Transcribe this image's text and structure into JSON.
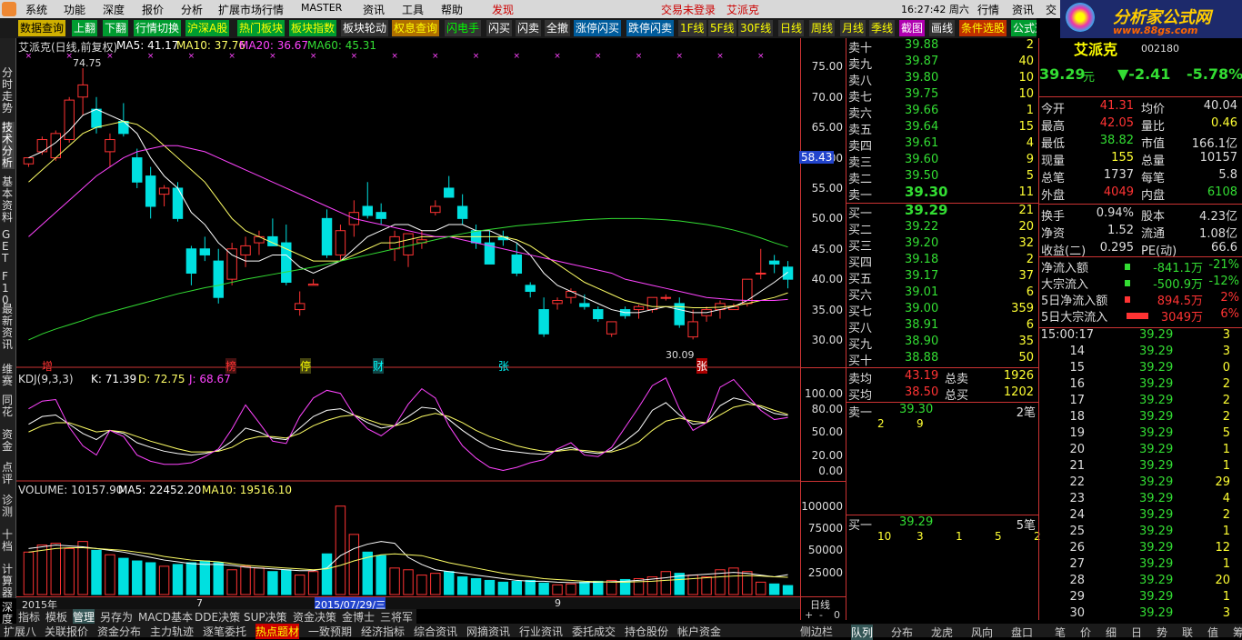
{
  "menu": {
    "items": [
      "系统",
      "功能",
      "深度",
      "报价",
      "分析",
      "扩展市场行情",
      "MASTER",
      "资讯",
      "工具",
      "帮助",
      "发现"
    ],
    "login": "交易未登录",
    "stock": "艾派克",
    "clock": "16:27:42 周六",
    "right": [
      "行情",
      "资讯",
      "交"
    ]
  },
  "toolbar": [
    "数据查询",
    "上翻",
    "下翻",
    "行情切换",
    "沪深A股",
    "热门板块",
    "板块指数",
    "板块轮动",
    "权息查询",
    "闪电手",
    "闪买",
    "闪卖",
    "全撤",
    "涨停闪买",
    "跌停闪卖",
    "1F线",
    "5F线",
    "30F线",
    "日线",
    "周线",
    "月线",
    "季线",
    "截图",
    "画线",
    "条件选股",
    "公式选"
  ],
  "logo": {
    "title": "分析家公式网",
    "url": "www.88gs.com"
  },
  "lefttabs": [
    "分时走势",
    "技术分析",
    "基本资料",
    "GET",
    "F10",
    "最新资讯",
    "维赛",
    "同花",
    "资金",
    "点评",
    "诊测",
    "十档",
    "计算器",
    "深度"
  ],
  "chart_data": [
    {
      "type": "candlestick",
      "title": "艾派克(日线,前复权)",
      "legend": [
        {
          "name": "MA5",
          "value": "41.17"
        },
        {
          "name": "MA10",
          "value": "37.76"
        },
        {
          "name": "MA20",
          "value": "36.67"
        },
        {
          "name": "MA60",
          "value": "45.31"
        }
      ],
      "ylim": [
        27,
        77
      ],
      "yticks": [
        "75.00",
        "70.00",
        "65.00",
        "60.00",
        "55.00",
        "50.00",
        "45.00",
        "40.00",
        "35.00",
        "30.00"
      ],
      "annotations": {
        "high": "74.75",
        "low": "30.09",
        "marker": "58.43"
      },
      "events": [
        "增",
        "榜",
        "停",
        "财",
        "张"
      ],
      "candles": [
        [
          59,
          60,
          58.5,
          60
        ],
        [
          61,
          63.5,
          60.5,
          63
        ],
        [
          60,
          64.5,
          59.5,
          64
        ],
        [
          63,
          70,
          62.5,
          69.5
        ],
        [
          70,
          74.75,
          67,
          72
        ],
        [
          68,
          70,
          64,
          65
        ],
        [
          61,
          64,
          58.5,
          63
        ],
        [
          66,
          69,
          63.5,
          64
        ],
        [
          60,
          61.5,
          55,
          56
        ],
        [
          57,
          58.5,
          50,
          52
        ],
        [
          54,
          55.5,
          52,
          55
        ],
        [
          55,
          56,
          49.5,
          50
        ],
        [
          45,
          45.5,
          39,
          41
        ],
        [
          45,
          47,
          43,
          44
        ],
        [
          43,
          45,
          36,
          37
        ],
        [
          40,
          46,
          39,
          45
        ],
        [
          44,
          47,
          42,
          45.5
        ],
        [
          46,
          48,
          44,
          47
        ],
        [
          47,
          50,
          45.5,
          45.5
        ],
        [
          46,
          49,
          39,
          39.5
        ],
        [
          35,
          38,
          34,
          36
        ],
        [
          39,
          40,
          39,
          39.2
        ],
        [
          50,
          51.5,
          43.5,
          44
        ],
        [
          44,
          49,
          43,
          48
        ],
        [
          49,
          53,
          47,
          51
        ],
        [
          52,
          56,
          50,
          50.5
        ],
        [
          51,
          52.5,
          49,
          50
        ],
        [
          45,
          48,
          43,
          47
        ],
        [
          44,
          47.5,
          42,
          47.5
        ],
        [
          46,
          48,
          45,
          46.5
        ],
        [
          51,
          53,
          50.5,
          52
        ],
        [
          55,
          57,
          53.5,
          53.5
        ],
        [
          52,
          54,
          49,
          50
        ],
        [
          48,
          49,
          45,
          46
        ],
        [
          46,
          48,
          42.5,
          42.5
        ],
        [
          47,
          48,
          45.5,
          46.5
        ],
        [
          44,
          46,
          40.5,
          41
        ],
        [
          39,
          39.5,
          37,
          38
        ],
        [
          35,
          37,
          30.5,
          31
        ],
        [
          36,
          37,
          35,
          36.5
        ],
        [
          37,
          38.5,
          36,
          38
        ],
        [
          36,
          37.5,
          35,
          35.5
        ],
        [
          35,
          35.5,
          33,
          33.5
        ],
        [
          31,
          33,
          30.5,
          33
        ],
        [
          35,
          35.5,
          33.5,
          34
        ],
        [
          35,
          35.8,
          33.5,
          35.5
        ],
        [
          35,
          37,
          34.5,
          37
        ],
        [
          37,
          37.5,
          36.5,
          37
        ],
        [
          36,
          37,
          32,
          32.5
        ],
        [
          30.5,
          35,
          30.09,
          33
        ],
        [
          34,
          35.5,
          33,
          35
        ],
        [
          35,
          36.5,
          33.5,
          36
        ],
        [
          35,
          36,
          35,
          35.5
        ],
        [
          36,
          40,
          35.5,
          40
        ],
        [
          41,
          45,
          40,
          41
        ],
        [
          43,
          44,
          41,
          42.5
        ],
        [
          42,
          43,
          38.5,
          40
        ]
      ],
      "ma5": [
        60,
        61,
        62.5,
        64.5,
        67,
        68,
        67,
        66,
        64,
        60,
        57,
        55,
        51,
        49,
        46,
        44,
        43,
        43,
        44,
        44,
        42,
        41,
        42,
        43,
        45,
        47,
        48,
        49,
        49,
        48,
        48,
        49,
        49,
        48,
        48,
        47,
        46,
        44,
        41,
        39,
        38,
        37,
        36,
        35,
        34.5,
        34.5,
        35,
        35.5,
        35,
        34.5,
        34.5,
        35,
        35.5,
        36.5,
        38,
        39.5,
        41.17
      ],
      "ma10": [
        56,
        58,
        60,
        62,
        64,
        65,
        65.5,
        66,
        65.5,
        64,
        62,
        60,
        58,
        56,
        53,
        50,
        48,
        47,
        46,
        45,
        44,
        43,
        43,
        43,
        44,
        45,
        46,
        46,
        46.5,
        47,
        47,
        47,
        47,
        47,
        47,
        47,
        46.5,
        45.5,
        44,
        42.5,
        41,
        39.5,
        38.5,
        37.5,
        36.5,
        36,
        35.5,
        35.5,
        35.5,
        35.3,
        35.3,
        35.4,
        35.6,
        36,
        36.5,
        37,
        37.76
      ],
      "ma20": [
        47,
        49,
        51,
        53,
        55,
        57,
        58.5,
        60,
        61,
        61.5,
        62,
        62,
        61.5,
        61,
        60,
        59,
        58,
        57,
        56,
        55,
        54,
        53,
        52,
        51,
        50,
        49.5,
        49,
        48.5,
        48,
        47.5,
        47,
        47,
        46.5,
        46,
        45.5,
        45,
        44.5,
        44,
        43.5,
        43,
        42.5,
        42,
        41.5,
        41,
        40,
        39.5,
        39,
        38.5,
        38,
        37.5,
        37,
        36.8,
        36.6,
        36.5,
        36.5,
        36.5,
        36.67
      ],
      "ma60": [
        30,
        31,
        31.8,
        32.5,
        33.2,
        34,
        34.6,
        35.2,
        35.8,
        36.4,
        37,
        37.6,
        38.1,
        38.6,
        39,
        39.5,
        40,
        40.4,
        40.8,
        41.2,
        41.6,
        42,
        42.5,
        43,
        43.5,
        44,
        44.5,
        45,
        45.5,
        46,
        46.5,
        47,
        47.5,
        47.9,
        48.2,
        48.5,
        48.8,
        49,
        49.2,
        49.4,
        49.6,
        49.8,
        49.9,
        50,
        50,
        50,
        49.9,
        49.8,
        49.6,
        49.3,
        49,
        48.6,
        48.1,
        47.5,
        46.8,
        46,
        45.31
      ]
    },
    {
      "type": "line",
      "title": "KDJ(9,3,3)",
      "legend": [
        {
          "name": "K",
          "value": "71.39"
        },
        {
          "name": "D",
          "value": "72.75"
        },
        {
          "name": "J",
          "value": "68.67"
        }
      ],
      "ylim": [
        -10,
        115
      ],
      "yticks": [
        "100.00",
        "80.00",
        "50.00",
        "20.00",
        "0.00"
      ],
      "k": [
        60,
        70,
        72,
        60,
        48,
        40,
        52,
        48,
        36,
        30,
        25,
        22,
        20,
        22,
        26,
        38,
        55,
        50,
        42,
        40,
        55,
        70,
        78,
        80,
        72,
        62,
        55,
        58,
        70,
        82,
        80,
        66,
        52,
        40,
        30,
        26,
        24,
        22,
        21,
        26,
        30,
        24,
        22,
        26,
        38,
        52,
        78,
        88,
        72,
        60,
        62,
        84,
        94,
        90,
        82,
        74,
        71.39
      ],
      "d": [
        50,
        58,
        62,
        62,
        56,
        50,
        52,
        50,
        44,
        38,
        33,
        28,
        24,
        24,
        25,
        30,
        40,
        44,
        44,
        42,
        48,
        58,
        65,
        70,
        72,
        66,
        60,
        58,
        62,
        70,
        74,
        70,
        62,
        52,
        44,
        38,
        32,
        28,
        25,
        25,
        27,
        26,
        24,
        24,
        29,
        37,
        52,
        64,
        68,
        64,
        62,
        72,
        82,
        86,
        84,
        78,
        72.75
      ],
      "j": [
        80,
        90,
        92,
        56,
        32,
        20,
        52,
        44,
        20,
        12,
        8,
        8,
        10,
        18,
        28,
        54,
        85,
        62,
        38,
        35,
        70,
        94,
        104,
        100,
        72,
        54,
        45,
        58,
        86,
        106,
        94,
        58,
        32,
        16,
        4,
        0,
        4,
        10,
        14,
        28,
        36,
        20,
        18,
        30,
        56,
        82,
        110,
        120,
        80,
        52,
        62,
        108,
        118,
        98,
        78,
        66,
        68.67
      ]
    },
    {
      "type": "bar",
      "title": "VOLUME",
      "legend": [
        {
          "name": "VOLUME",
          "value": "10157.90"
        },
        {
          "name": "MA5",
          "value": "22452.20"
        },
        {
          "name": "MA10",
          "value": "19516.10"
        }
      ],
      "ylim": [
        0,
        110000
      ],
      "yticks": [
        "100000",
        "75000",
        "50000",
        "25000"
      ],
      "xlabels": [
        "2015年",
        "7",
        "2015/07/29/三",
        "9"
      ],
      "values": [
        48000,
        56000,
        58000,
        52000,
        60000,
        50000,
        45000,
        41000,
        38000,
        36000,
        32000,
        34000,
        36000,
        38000,
        36000,
        28000,
        32000,
        30000,
        26000,
        28000,
        22000,
        26000,
        46000,
        100000,
        68000,
        48000,
        44000,
        30000,
        28000,
        22000,
        24000,
        26000,
        20000,
        18000,
        16000,
        14000,
        15000,
        16000,
        13000,
        11000,
        12000,
        14000,
        15000,
        16000,
        17000,
        18000,
        20000,
        26000,
        24000,
        22000,
        20000,
        28000,
        30000,
        26000,
        14000,
        12000,
        10157.9
      ],
      "ma5": [
        52000,
        54000,
        56000,
        55000,
        54000,
        52000,
        50000,
        48000,
        45000,
        42000,
        39000,
        37000,
        35000,
        34000,
        34000,
        33000,
        31000,
        30000,
        29000,
        28000,
        27000,
        27000,
        30000,
        44000,
        52000,
        57000,
        60000,
        58000,
        42000,
        34000,
        28000,
        26000,
        24000,
        22000,
        20000,
        18000,
        16000,
        15000,
        15000,
        14000,
        13500,
        13500,
        14000,
        14500,
        15000,
        16000,
        17500,
        19000,
        21000,
        22000,
        23000,
        24000,
        25000,
        24000,
        22000,
        20000,
        22452.2
      ],
      "ma10": [
        48000,
        50000,
        52000,
        53000,
        53000,
        52000,
        51000,
        50000,
        48000,
        46000,
        43000,
        41000,
        39000,
        38000,
        37000,
        35000,
        33000,
        32000,
        31000,
        30000,
        29000,
        28000,
        29000,
        33000,
        38000,
        42000,
        45000,
        46000,
        45000,
        44000,
        40000,
        36000,
        33000,
        30000,
        27000,
        24000,
        22000,
        20000,
        18000,
        17000,
        16000,
        15000,
        14500,
        14000,
        14000,
        14500,
        15000,
        16000,
        17000,
        18000,
        19000,
        20000,
        21000,
        21500,
        21000,
        20000,
        19516.1
      ]
    }
  ],
  "chart_right_label": "日线",
  "orderbook": {
    "sell": [
      [
        "卖十",
        "39.88",
        "2"
      ],
      [
        "卖九",
        "39.87",
        "40"
      ],
      [
        "卖八",
        "39.80",
        "10"
      ],
      [
        "卖七",
        "39.75",
        "10"
      ],
      [
        "卖六",
        "39.66",
        "1"
      ],
      [
        "卖五",
        "39.64",
        "15"
      ],
      [
        "卖四",
        "39.61",
        "4"
      ],
      [
        "卖三",
        "39.60",
        "9"
      ],
      [
        "卖二",
        "39.50",
        "5"
      ],
      [
        "卖一",
        "39.30",
        "11"
      ]
    ],
    "buy": [
      [
        "买一",
        "39.29",
        "21"
      ],
      [
        "买二",
        "39.22",
        "20"
      ],
      [
        "买三",
        "39.20",
        "32"
      ],
      [
        "买四",
        "39.18",
        "2"
      ],
      [
        "买五",
        "39.17",
        "37"
      ],
      [
        "买六",
        "39.01",
        "6"
      ],
      [
        "买七",
        "39.00",
        "359"
      ],
      [
        "买八",
        "38.91",
        "6"
      ],
      [
        "买九",
        "38.90",
        "35"
      ],
      [
        "买十",
        "38.88",
        "50"
      ]
    ],
    "avg_sell": {
      "label": "卖均",
      "value": "43.19",
      "tlabel": "总卖",
      "total": "1926"
    },
    "avg_buy": {
      "label": "买均",
      "value": "38.50",
      "tlabel": "总买",
      "total": "1202"
    },
    "queue1": {
      "label": "卖一",
      "price": "39.30",
      "count": "2笔",
      "orders": [
        "2",
        "9"
      ]
    },
    "queue2": {
      "label": "买一",
      "price": "39.29",
      "count": "5笔",
      "orders": [
        "10",
        "3",
        "1",
        "5",
        "2"
      ]
    }
  },
  "quote": {
    "name": "艾派克",
    "code": "002180",
    "price": "39.29",
    "unit": "元",
    "change": "▼-2.41",
    "pct": "-5.78%",
    "stats": [
      [
        "今开",
        "41.31",
        "均价",
        "40.04"
      ],
      [
        "最高",
        "42.05",
        "量比",
        "0.46"
      ],
      [
        "最低",
        "38.82",
        "市值",
        "166.1亿"
      ],
      [
        "现量",
        "155",
        "总量",
        "10157"
      ],
      [
        "总笔",
        "1737",
        "每笔",
        "5.8"
      ],
      [
        "外盘",
        "4049",
        "内盘",
        "6108"
      ]
    ],
    "stats2": [
      [
        "换手",
        "0.94%",
        "股本",
        "4.23亿"
      ],
      [
        "净资",
        "1.52",
        "流通",
        "1.08亿"
      ],
      [
        "收益(二)",
        "0.295",
        "PE(动)",
        "66.6"
      ]
    ],
    "flows": [
      [
        "净流入额",
        "-841.1万",
        "-21%"
      ],
      [
        "大宗流入",
        "-500.9万",
        "-12%"
      ],
      [
        "5日净流入额",
        "894.5万",
        "2%"
      ],
      [
        "5日大宗流入",
        "3049万",
        "6%"
      ]
    ]
  },
  "ticks": [
    [
      "15:00:17",
      "39.29",
      "3"
    ],
    [
      "14",
      "39.29",
      "3"
    ],
    [
      "15",
      "39.29",
      "0"
    ],
    [
      "16",
      "39.29",
      "2"
    ],
    [
      "17",
      "39.29",
      "2"
    ],
    [
      "18",
      "39.29",
      "2"
    ],
    [
      "19",
      "39.29",
      "5"
    ],
    [
      "20",
      "39.29",
      "1"
    ],
    [
      "21",
      "39.29",
      "1"
    ],
    [
      "22",
      "39.29",
      "29"
    ],
    [
      "23",
      "39.29",
      "4"
    ],
    [
      "24",
      "39.29",
      "2"
    ],
    [
      "25",
      "39.29",
      "1"
    ],
    [
      "26",
      "39.29",
      "12"
    ],
    [
      "27",
      "39.29",
      "1"
    ],
    [
      "28",
      "39.29",
      "20"
    ],
    [
      "29",
      "39.29",
      "1"
    ],
    [
      "30",
      "39.29",
      "3"
    ]
  ],
  "bottomtabs": [
    "指标",
    "模板",
    "管理",
    "另存为",
    "MACD基本",
    "DDE决策",
    "SUP决策",
    "资金决策",
    "金博士",
    "三将军"
  ],
  "bottomtabs2": [
    "扩展八",
    "关联报价",
    "资金分布",
    "主力轨迹",
    "逐笔委托",
    "热点题材",
    "一致预期",
    "经济指标",
    "综合资讯",
    "网摘资讯",
    "行业资讯",
    "委托成交",
    "持仓股份",
    "帐户资金"
  ],
  "righttabs": [
    "队列",
    "分布",
    "龙虎",
    "风向",
    "盘口",
    "笔",
    "价",
    "细",
    "日",
    "势",
    "联",
    "值",
    "筹"
  ],
  "axis_bottom": {
    "label": "日线",
    "nav": [
      "+",
      "-",
      "0"
    ],
    "side": "侧边栏"
  }
}
